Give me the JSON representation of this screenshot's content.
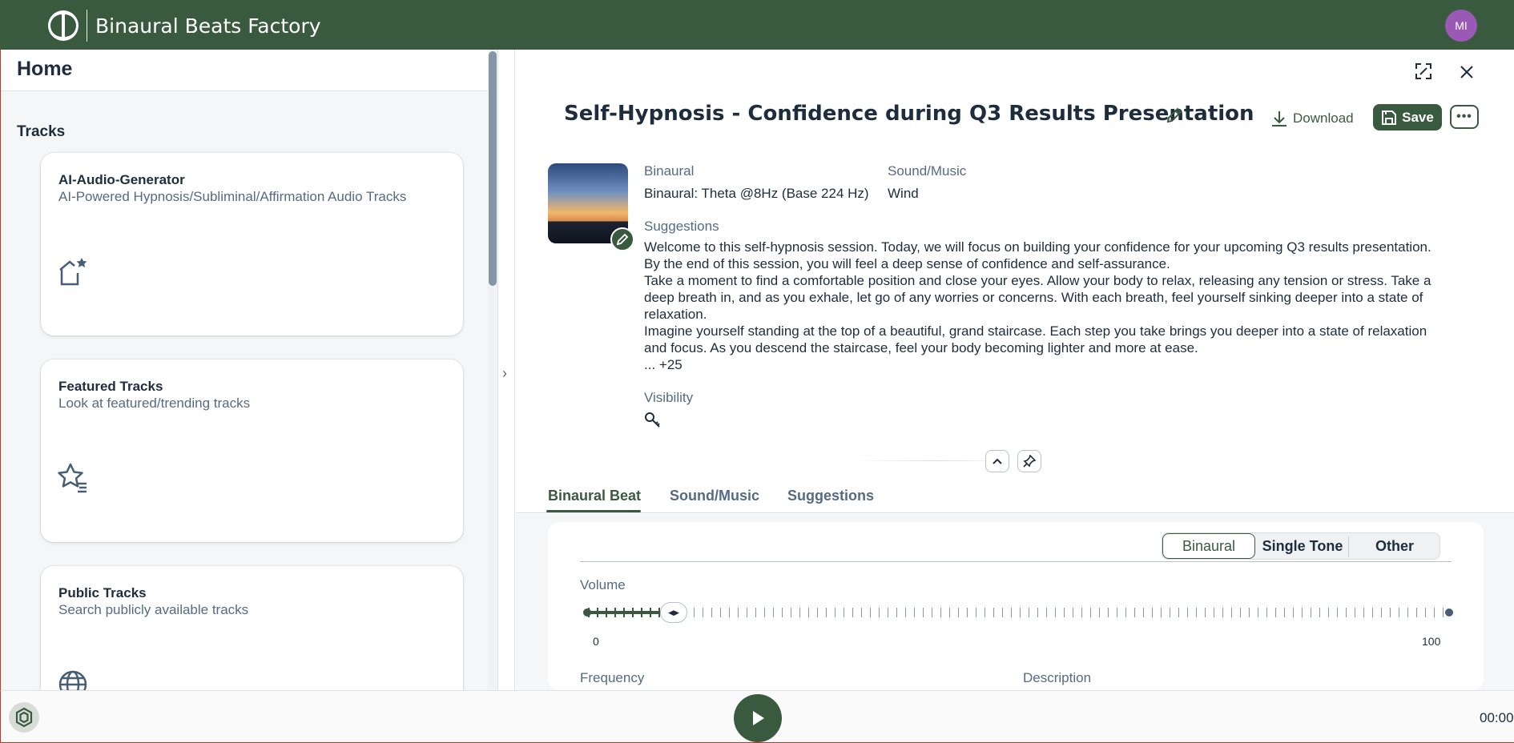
{
  "app": {
    "title": "Binaural Beats Factory",
    "avatar_initials": "MI",
    "brand_color": "#3a5a40"
  },
  "left_pane": {
    "title": "Home",
    "section_label": "Tracks",
    "tiles": [
      {
        "title": "AI-Audio-Generator",
        "subtitle": "AI-Powered Hypnosis/Subliminal/Affirmation Audio Tracks",
        "icon": "home-star-icon"
      },
      {
        "title": "Featured Tracks",
        "subtitle": "Look at featured/trending tracks",
        "icon": "star-list-icon"
      },
      {
        "title": "Public Tracks",
        "subtitle": "Search publicly available tracks",
        "icon": "globe-icon"
      }
    ]
  },
  "object_page": {
    "title": "Self-Hypnosis - Confidence during Q3 Results Presentation",
    "download_label": "Download",
    "save_label": "Save",
    "more_label": "•••",
    "fields": {
      "binaural_label": "Binaural",
      "binaural_value": "Binaural: Theta @8Hz (Base 224 Hz)",
      "sound_label": "Sound/Music",
      "sound_value": "Wind",
      "suggestions_label": "Suggestions",
      "suggestions_lines": [
        "Welcome to this self-hypnosis session. Today, we will focus on building your confidence for your upcoming Q3 results presentation.",
        "By the end of this session, you will feel a deep sense of confidence and self-assurance.",
        "Take a moment to find a comfortable position and close your eyes. Allow your body to relax, releasing any tension or stress. Take a deep breath in, and as you exhale, let go of any worries or concerns. With each breath, feel yourself sinking deeper into a state of relaxation.",
        "Imagine yourself standing at the top of a beautiful, grand staircase. Each step you take brings you deeper into a state of relaxation and focus. As you descend the staircase, feel your body becoming lighter and more at ease.",
        "... +25"
      ],
      "visibility_label": "Visibility"
    },
    "tabs": [
      {
        "label": "Binaural Beat",
        "active": true
      },
      {
        "label": "Sound/Music",
        "active": false
      },
      {
        "label": "Suggestions",
        "active": false
      }
    ],
    "segmented": {
      "options": [
        "Binaural",
        "Single Tone",
        "Other"
      ],
      "selected": "Binaural"
    },
    "volume": {
      "label": "Volume",
      "min_label": "0",
      "max_label": "100",
      "value": 10
    },
    "frequency_label": "Frequency",
    "description_label": "Description"
  },
  "player": {
    "time": "00:00"
  }
}
